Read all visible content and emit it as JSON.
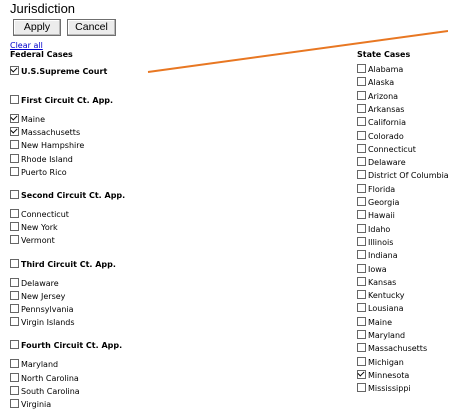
{
  "title": "Jurisdiction",
  "buttons": {
    "apply": "Apply",
    "cancel": "Cancel"
  },
  "clear_all": "Clear all",
  "federal": {
    "header": "Federal Cases",
    "items": [
      {
        "label": "U.S.Supreme Court",
        "checked": true,
        "bold": true
      },
      {
        "label": "First Circuit Ct. App.",
        "checked": false,
        "bold": true
      },
      {
        "label": "Maine",
        "checked": true,
        "bold": false
      },
      {
        "label": "Massachusetts",
        "checked": true,
        "bold": false
      },
      {
        "label": "New Hampshire",
        "checked": false,
        "bold": false
      },
      {
        "label": "Rhode Island",
        "checked": false,
        "bold": false
      },
      {
        "label": "Puerto Rico",
        "checked": false,
        "bold": false
      },
      {
        "label": "Second Circuit Ct. App.",
        "checked": false,
        "bold": true
      },
      {
        "label": "Connecticut",
        "checked": false,
        "bold": false
      },
      {
        "label": "New York",
        "checked": false,
        "bold": false
      },
      {
        "label": "Vermont",
        "checked": false,
        "bold": false
      },
      {
        "label": "Third Circuit Ct. App.",
        "checked": false,
        "bold": true
      },
      {
        "label": "Delaware",
        "checked": false,
        "bold": false
      },
      {
        "label": "New Jersey",
        "checked": false,
        "bold": false
      },
      {
        "label": "Pennsylvania",
        "checked": false,
        "bold": false
      },
      {
        "label": "Virgin Islands",
        "checked": false,
        "bold": false
      },
      {
        "label": "Fourth Circuit Ct. App.",
        "checked": false,
        "bold": true
      },
      {
        "label": "Maryland",
        "checked": false,
        "bold": false
      },
      {
        "label": "North Carolina",
        "checked": false,
        "bold": false
      },
      {
        "label": "South Carolina",
        "checked": false,
        "bold": false
      },
      {
        "label": "Virginia",
        "checked": false,
        "bold": false
      }
    ]
  },
  "state": {
    "header": "State Cases",
    "items": [
      {
        "label": "Alabama",
        "checked": false
      },
      {
        "label": "Alaska",
        "checked": false
      },
      {
        "label": "Arizona",
        "checked": false
      },
      {
        "label": "Arkansas",
        "checked": false
      },
      {
        "label": "California",
        "checked": false
      },
      {
        "label": "Colorado",
        "checked": false
      },
      {
        "label": "Connecticut",
        "checked": false
      },
      {
        "label": "Delaware",
        "checked": false
      },
      {
        "label": "District Of Columbia",
        "checked": false
      },
      {
        "label": "Florida",
        "checked": false
      },
      {
        "label": "Georgia",
        "checked": false
      },
      {
        "label": "Hawaii",
        "checked": false
      },
      {
        "label": "Idaho",
        "checked": false
      },
      {
        "label": "Illinois",
        "checked": false
      },
      {
        "label": "Indiana",
        "checked": false
      },
      {
        "label": "Iowa",
        "checked": false
      },
      {
        "label": "Kansas",
        "checked": false
      },
      {
        "label": "Kentucky",
        "checked": false
      },
      {
        "label": "Lousiana",
        "checked": false
      },
      {
        "label": "Maine",
        "checked": false
      },
      {
        "label": "Maryland",
        "checked": false
      },
      {
        "label": "Massachusetts",
        "checked": false
      },
      {
        "label": "Michigan",
        "checked": false
      },
      {
        "label": "Minnesota",
        "checked": true
      },
      {
        "label": "Mississippi",
        "checked": false
      }
    ]
  },
  "annotation": {
    "color": "#e87722"
  }
}
